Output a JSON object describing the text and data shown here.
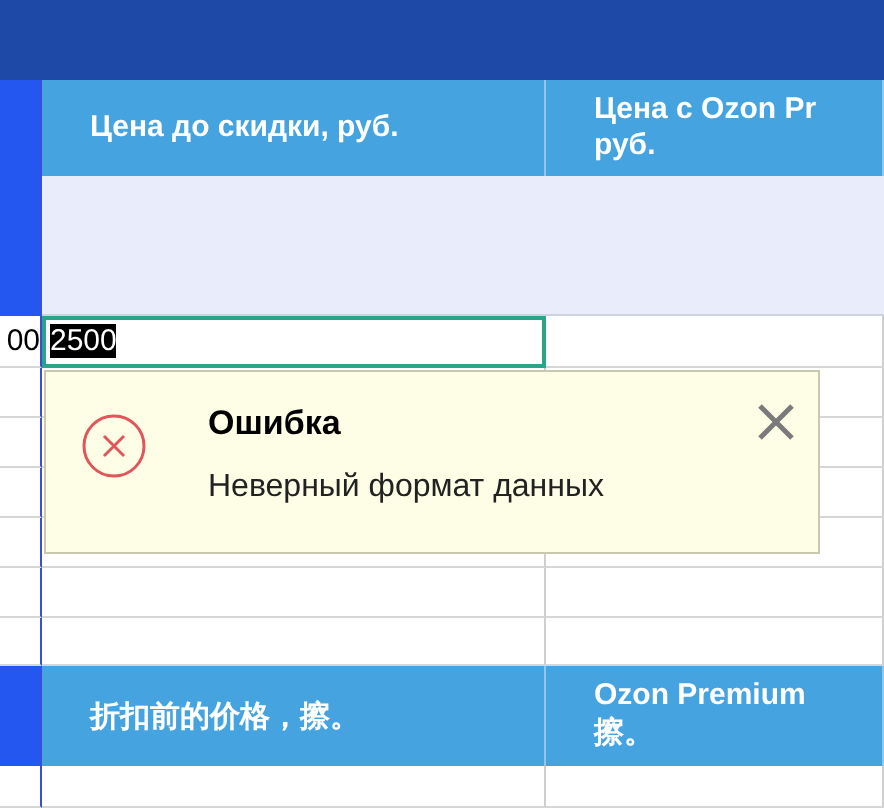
{
  "header_row": {
    "cells": [
      {
        "lines": [
          "Цена до скидки, руб."
        ]
      },
      {
        "lines": [
          "Цена с Ozon Pr",
          "руб."
        ]
      }
    ]
  },
  "edit_row": {
    "row_stub": "00",
    "value": "2500",
    "selected": true
  },
  "error_popup": {
    "title": "Ошибка",
    "message": "Неверный формат данных"
  },
  "translation_row": {
    "cells": [
      {
        "lines": [
          "折扣前的价格，擦。"
        ]
      },
      {
        "lines": [
          "Ozon Premium",
          "擦。"
        ]
      }
    ]
  }
}
